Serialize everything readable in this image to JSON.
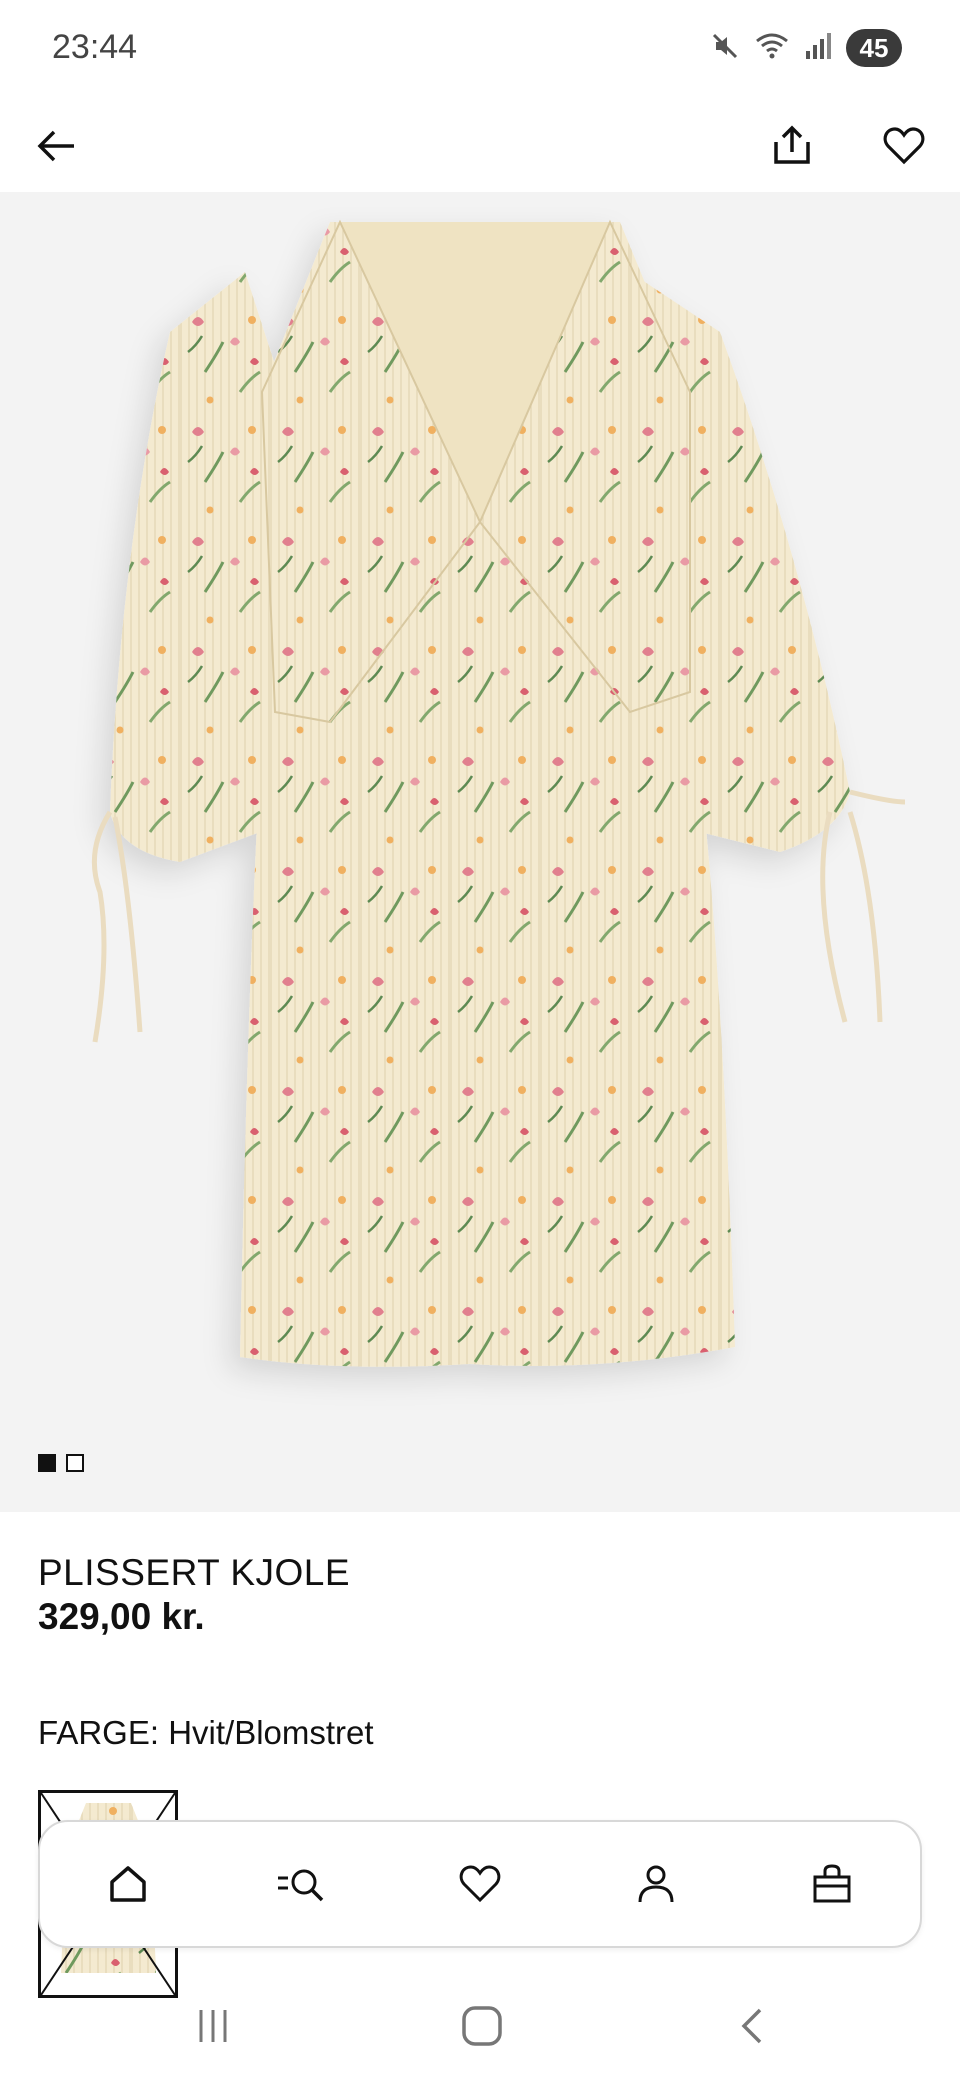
{
  "status_bar": {
    "time": "23:44",
    "battery": "45",
    "icons": [
      "mute-icon",
      "wifi-icon",
      "signal-icon",
      "battery-icon"
    ]
  },
  "top_nav": {
    "icons": [
      "back-arrow-icon",
      "share-icon",
      "heart-icon"
    ]
  },
  "gallery": {
    "image": "floral-pleated-dress",
    "dot_count": 2,
    "active_dot": 1
  },
  "product": {
    "name": "PLISSERT KJOLE",
    "price": "329,00 kr.",
    "color_label": "FARGE:",
    "color_value": "Hvit/Blomstret"
  },
  "bottom_nav": {
    "items": [
      "home-icon",
      "search-icon",
      "favorites-icon",
      "account-icon",
      "bag-icon"
    ]
  },
  "system_nav": {
    "icons": [
      "recents-icon",
      "home-button-icon",
      "back-icon"
    ]
  },
  "colors": {
    "dress_base": "#f4ead0",
    "flower_pink": "#e17f8e",
    "leaf_green": "#6f9a5e",
    "background_gray": "#f3f3f3"
  }
}
